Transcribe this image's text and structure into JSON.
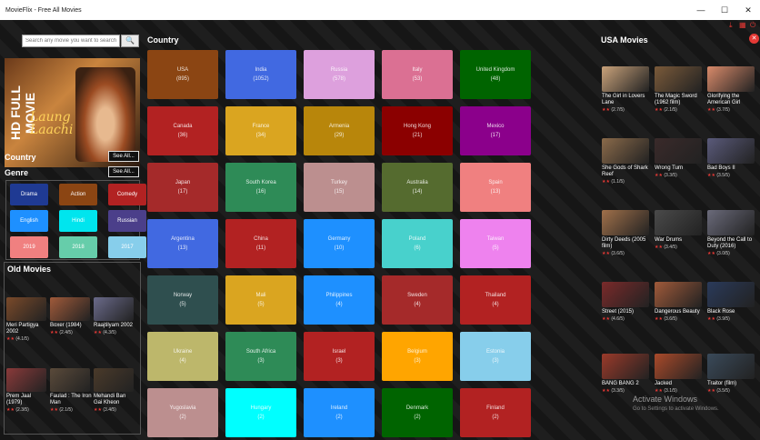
{
  "window": {
    "title": "MovieFlix - Free All Movies",
    "minimize": "—",
    "maximize": "☐",
    "close": "✕"
  },
  "toolbar": {
    "download_icon": "⤓",
    "grid_icon": "▦",
    "power_icon": "⏻",
    "close_icon": "✕"
  },
  "search": {
    "placeholder": "Search any movie you want to search",
    "button": "🔍"
  },
  "featured": {
    "tag": "HD FULL MOVIE",
    "title_line1": "Laung",
    "title_line2": "Laachi"
  },
  "sections": {
    "country": "Country",
    "genre": "Genre",
    "see_all": "See All...",
    "old_movies": "Old Movies",
    "country_heading": "Country",
    "usa_heading": "USA Movies"
  },
  "genres": [
    {
      "label": "Drama",
      "color": "#1f3a93"
    },
    {
      "label": "Action",
      "color": "#8b4513"
    },
    {
      "label": "Comedy",
      "color": "#b22222"
    },
    {
      "label": "English",
      "color": "#1e90ff"
    },
    {
      "label": "Hindi",
      "color": "#00e5ee"
    },
    {
      "label": "Russian",
      "color": "#4b3f8a"
    },
    {
      "label": "2019",
      "color": "#f08080"
    },
    {
      "label": "2018",
      "color": "#66cdaa"
    },
    {
      "label": "2017",
      "color": "#87ceeb"
    }
  ],
  "old_movies": [
    {
      "title": "Meri Partigya 2002",
      "rating": "(4.1/5)",
      "color": "#7a4a2a"
    },
    {
      "title": "Boxer (1984)",
      "rating": "(2.4/5)",
      "color": "#a05a3a"
    },
    {
      "title": "Raajtilyam 2002",
      "rating": "(4.3/5)",
      "color": "#6a6a8a"
    },
    {
      "title": "Prem Jaal (1979)",
      "rating": "(2.3/5)",
      "color": "#8a3a3a"
    },
    {
      "title": "Faulad : The Iron Man",
      "rating": "(2.1/5)",
      "color": "#5a4a3a"
    },
    {
      "title": "Mehandi Ban Gai Kheon",
      "rating": "(3.4/5)",
      "color": "#4a3a2a"
    }
  ],
  "countries": [
    {
      "name": "USA",
      "count": "(895)",
      "color": "#8b4513"
    },
    {
      "name": "India",
      "count": "(1052)",
      "color": "#4169e1"
    },
    {
      "name": "Russia",
      "count": "(578)",
      "color": "#dda0dd"
    },
    {
      "name": "Italy",
      "count": "(53)",
      "color": "#db7093"
    },
    {
      "name": "United Kingdom",
      "count": "(48)",
      "color": "#006400"
    },
    {
      "name": "Canada",
      "count": "(36)",
      "color": "#b22222"
    },
    {
      "name": "France",
      "count": "(34)",
      "color": "#daa520"
    },
    {
      "name": "Armenia",
      "count": "(29)",
      "color": "#b8860b"
    },
    {
      "name": "Hong Kong",
      "count": "(21)",
      "color": "#8b0000"
    },
    {
      "name": "Mexico",
      "count": "(17)",
      "color": "#8b008b"
    },
    {
      "name": "Japan",
      "count": "(17)",
      "color": "#a52a2a"
    },
    {
      "name": "South Korea",
      "count": "(16)",
      "color": "#2e8b57"
    },
    {
      "name": "Turkey",
      "count": "(15)",
      "color": "#bc8f8f"
    },
    {
      "name": "Australia",
      "count": "(14)",
      "color": "#556b2f"
    },
    {
      "name": "Spain",
      "count": "(13)",
      "color": "#f08080"
    },
    {
      "name": "Argentina",
      "count": "(13)",
      "color": "#4169e1"
    },
    {
      "name": "China",
      "count": "(11)",
      "color": "#b22222"
    },
    {
      "name": "Germany",
      "count": "(10)",
      "color": "#1e90ff"
    },
    {
      "name": "Poland",
      "count": "(6)",
      "color": "#48d1cc"
    },
    {
      "name": "Taiwan",
      "count": "(5)",
      "color": "#ee82ee"
    },
    {
      "name": "Norway",
      "count": "(5)",
      "color": "#2f4f4f"
    },
    {
      "name": "Mali",
      "count": "(5)",
      "color": "#daa520"
    },
    {
      "name": "Philippines",
      "count": "(4)",
      "color": "#1e90ff"
    },
    {
      "name": "Sweden",
      "count": "(4)",
      "color": "#a52a2a"
    },
    {
      "name": "Thailand",
      "count": "(4)",
      "color": "#b22222"
    },
    {
      "name": "Ukraine",
      "count": "(4)",
      "color": "#bdb76b"
    },
    {
      "name": "South Africa",
      "count": "(3)",
      "color": "#2e8b57"
    },
    {
      "name": "Israel",
      "count": "(3)",
      "color": "#b22222"
    },
    {
      "name": "Belgium",
      "count": "(3)",
      "color": "#ffa500"
    },
    {
      "name": "Estonia",
      "count": "(3)",
      "color": "#87ceeb"
    },
    {
      "name": "Yugoslavia",
      "count": "(2)",
      "color": "#bc8f8f"
    },
    {
      "name": "Hungary",
      "count": "(2)",
      "color": "#00ffff"
    },
    {
      "name": "Ireland",
      "count": "(2)",
      "color": "#1e90ff"
    },
    {
      "name": "Denmark",
      "count": "(2)",
      "color": "#006400"
    },
    {
      "name": "Finland",
      "count": "(2)",
      "color": "#b22222"
    }
  ],
  "usa_movies": [
    {
      "title": "The Girl in Lovers Lane",
      "rating": "(2.7/5)",
      "color": "#c9a27a"
    },
    {
      "title": "The Magic Sword (1962 film)",
      "rating": "(2.1/5)",
      "color": "#7a5a3a"
    },
    {
      "title": "Glorifying the American Girl",
      "rating": "(3.7/5)",
      "color": "#d98a6a"
    },
    {
      "title": "She Gods of Shark Reef",
      "rating": "(1.1/5)",
      "color": "#8a6a4a"
    },
    {
      "title": "Wrong Turn",
      "rating": "(3.3/5)",
      "color": "#3a2a2a"
    },
    {
      "title": "Bad Boys II",
      "rating": "(3.5/5)",
      "color": "#5a5a7a"
    },
    {
      "title": "Dirty Deeds (2005 film)",
      "rating": "(3.6/5)",
      "color": "#a0704a"
    },
    {
      "title": "War Drums",
      "rating": "(3.4/5)",
      "color": "#4a4a4a"
    },
    {
      "title": "Beyond the Call to Duty (2016)",
      "rating": "(3.0/5)",
      "color": "#6a6a7a"
    },
    {
      "title": "Street (2015)",
      "rating": "(4.6/5)",
      "color": "#7a2a2a"
    },
    {
      "title": "Dangerous Beauty",
      "rating": "(3.6/5)",
      "color": "#a05a3a"
    },
    {
      "title": "Black Rose",
      "rating": "(3.9/5)",
      "color": "#2a3a5a"
    },
    {
      "title": "BANG BANG 2",
      "rating": "(3.3/5)",
      "color": "#9a3a2a"
    },
    {
      "title": "Jacked",
      "rating": "(3.1/5)",
      "color": "#aa4a2a"
    },
    {
      "title": "Traitor (film)",
      "rating": "(3.5/5)",
      "color": "#3a4a5a"
    }
  ],
  "activation": {
    "line1": "Activate Windows",
    "line2": "Go to Settings to activate Windows."
  }
}
